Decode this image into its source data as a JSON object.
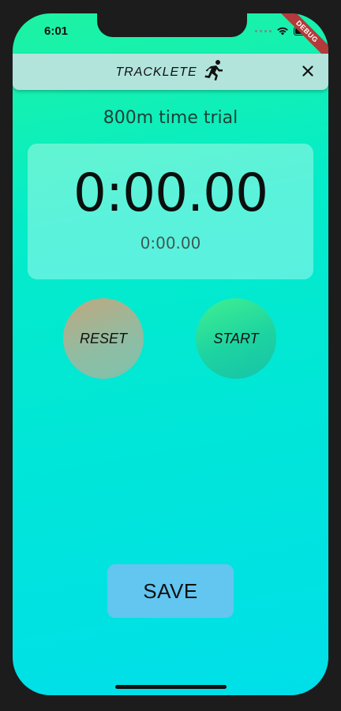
{
  "status_bar": {
    "time": "6:01",
    "debug_label": "DEBUG"
  },
  "app_bar": {
    "title": "TRACKLETE",
    "logo_icon": "runner-icon",
    "close_icon": "close-icon"
  },
  "event": {
    "title": "800m time trial"
  },
  "timer": {
    "main_time": "0:00.00",
    "secondary_time": "0:00.00"
  },
  "controls": {
    "reset_label": "RESET",
    "start_label": "START",
    "save_label": "SAVE"
  },
  "colors": {
    "gradient_top": "#1ef3a2",
    "gradient_bottom": "#00dfe9",
    "app_bar": "#b2e4dc",
    "save_button": "#62c6f1",
    "debug_ribbon": "#b33a3a"
  }
}
